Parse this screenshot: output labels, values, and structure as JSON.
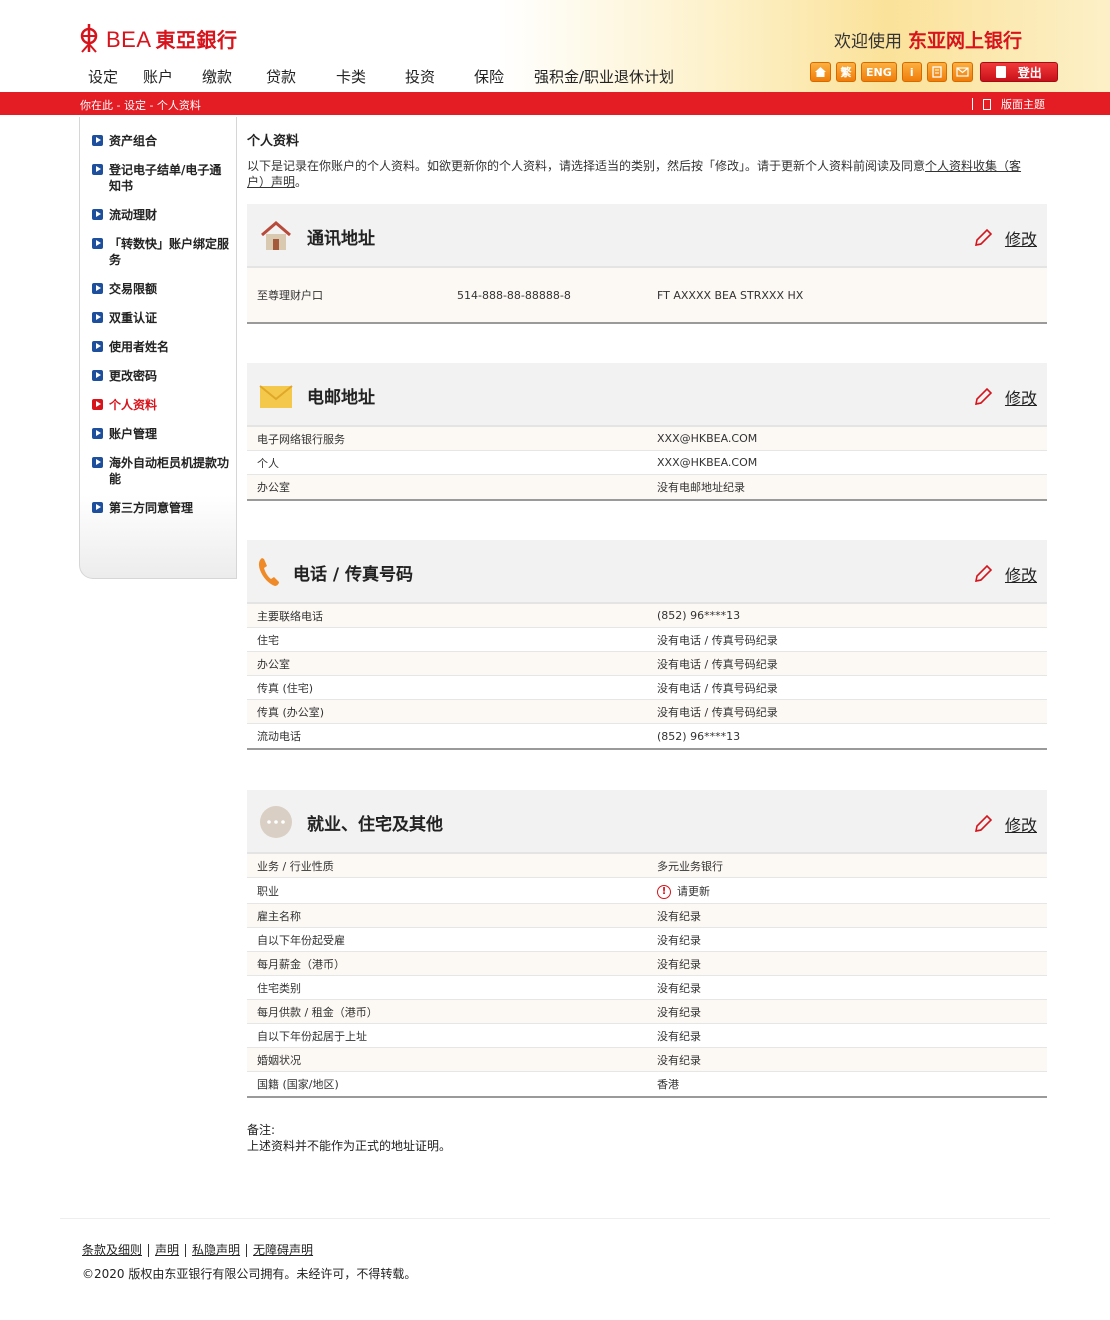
{
  "header": {
    "logo_text": "BEA",
    "logo_cn": "東亞銀行",
    "welcome_prefix": "欢迎使用",
    "welcome_brand": "东亚网上银行",
    "nav": [
      "设定",
      "账户",
      "缴款",
      "贷款",
      "卡类",
      "投资",
      "保险",
      "强积金/职业退休计划"
    ],
    "tools": [
      "home",
      "繁",
      "ENG",
      "i",
      "print",
      "mail"
    ],
    "logout_label": "登出"
  },
  "redbar": {
    "breadcrumb": "你在此 - 设定 - 个人资料",
    "theme_label": "版面主题"
  },
  "sidebar": {
    "items": [
      {
        "label": "资产组合"
      },
      {
        "label": "登记电子结单/电子通知书"
      },
      {
        "label": "流动理财"
      },
      {
        "label": "「转数快」账户绑定服务"
      },
      {
        "label": "交易限额"
      },
      {
        "label": "双重认证"
      },
      {
        "label": "使用者姓名"
      },
      {
        "label": "更改密码"
      },
      {
        "label": "个人资料"
      },
      {
        "label": "账户管理"
      },
      {
        "label": "海外自动柜员机提款功能"
      },
      {
        "label": "第三方同意管理"
      }
    ]
  },
  "main": {
    "title": "个人资料",
    "intro_text": "以下是记录在你账户的个人资料。如欲更新你的个人资料，请选择适当的类别，然后按「修改」。请于更新个人资料前阅读及同意",
    "intro_link": "个人资料收集（客户）声明",
    "intro_end": "。",
    "edit_label": "修改",
    "address": {
      "title": "通讯地址",
      "row": {
        "type": "至尊理财户口",
        "account": "514-888-88-88888-8",
        "address": "FT AXXXX BEA STRXXX HX"
      }
    },
    "email": {
      "title": "电邮地址",
      "rows": [
        {
          "label": "电子网络银行服务",
          "value": "XXX@HKBEA.COM"
        },
        {
          "label": "个人",
          "value": "XXX@HKBEA.COM"
        },
        {
          "label": "办公室",
          "value": "没有电邮地址纪录"
        }
      ]
    },
    "phone": {
      "title": "电话 / 传真号码",
      "rows": [
        {
          "label": "主要联络电话",
          "value": "(852)  96****13"
        },
        {
          "label": "住宅",
          "value": "没有电话 / 传真号码纪录"
        },
        {
          "label": "办公室",
          "value": "没有电话 / 传真号码纪录"
        },
        {
          "label": "传真 (住宅)",
          "value": "没有电话 / 传真号码纪录"
        },
        {
          "label": "传真 (办公室)",
          "value": "没有电话 / 传真号码纪录"
        },
        {
          "label": "流动电话",
          "value": "(852)  96****13"
        }
      ]
    },
    "other": {
      "title": "就业、住宅及其他",
      "rows": [
        {
          "label": "业务 / 行业性质",
          "value": "多元业务银行"
        },
        {
          "label": "职业",
          "value": "请更新"
        },
        {
          "label": "雇主名称",
          "value": "没有纪录"
        },
        {
          "label": "自以下年份起受雇",
          "value": "没有纪录"
        },
        {
          "label": "每月薪金（港币）",
          "value": "没有纪录"
        },
        {
          "label": "住宅类别",
          "value": "没有纪录"
        },
        {
          "label": "每月供款 / 租金（港币）",
          "value": "没有纪录"
        },
        {
          "label": "自以下年份起居于上址",
          "value": "没有纪录"
        },
        {
          "label": "婚姻状况",
          "value": "没有纪录"
        },
        {
          "label": "国籍 (国家/地区)",
          "value": "香港"
        }
      ]
    },
    "note_title": "备注:",
    "note_text": "上述资料并不能作为正式的地址证明。"
  },
  "footer": {
    "links": [
      "条款及细则",
      "声明",
      "私隐声明",
      "无障碍声明"
    ],
    "copyright": "©2020 版权由东亚银行有限公司拥有。未经许可，不得转载。"
  },
  "colors": {
    "brand_red": "#d7141c",
    "nav_blue": "#1d4f9c",
    "tool_orange": "#f28c1c"
  }
}
